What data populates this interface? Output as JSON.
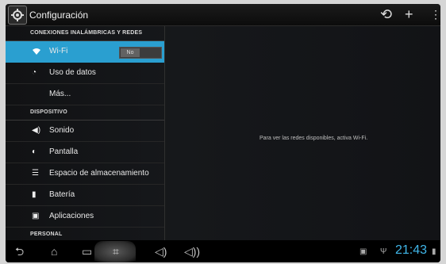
{
  "actionbar": {
    "title": "Configuración",
    "icons": [
      "gear-app-icon",
      "sync-icon",
      "add-icon",
      "overflow-menu-icon"
    ]
  },
  "sections": {
    "wireless": "CONEXIONES INALÁMBRICAS Y REDES",
    "device": "DISPOSITIVO",
    "personal": "PERSONAL"
  },
  "items": {
    "wifi": "Wi-Fi",
    "wifi_toggle": "No",
    "data_usage": "Uso de datos",
    "more": "Más...",
    "sound": "Sonido",
    "display": "Pantalla",
    "storage": "Espacio de almacenamiento",
    "battery": "Batería",
    "apps": "Aplicaciones"
  },
  "main": {
    "message": "Para ver las redes disponibles, activa Wi-Fi."
  },
  "statusbar": {
    "time": "21:43"
  },
  "colors": {
    "selected": "#2a9fd0",
    "time": "#40b7ea"
  }
}
